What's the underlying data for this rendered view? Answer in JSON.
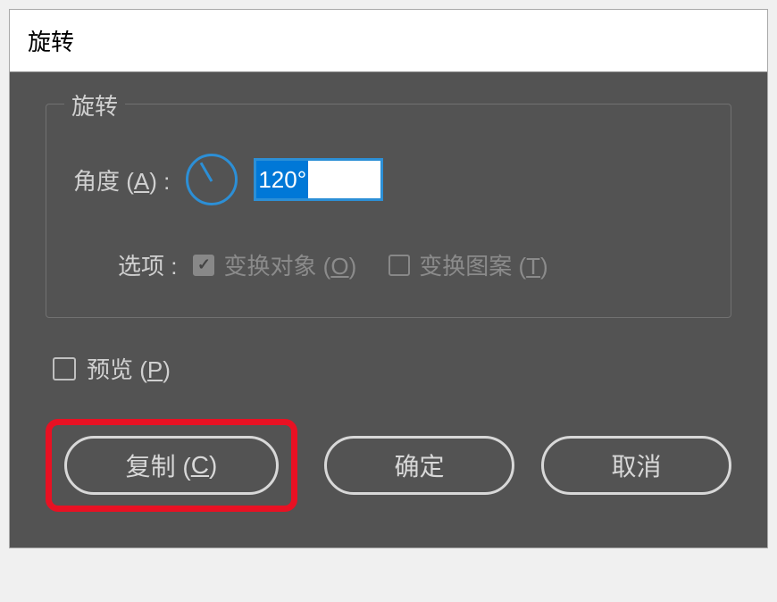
{
  "dialog": {
    "title": "旋转"
  },
  "fieldset": {
    "legend": "旋转",
    "angle_label_prefix": "角度 (",
    "angle_label_hotkey": "A",
    "angle_label_suffix": ") :",
    "angle_value": "120°"
  },
  "options": {
    "label": "选项 :",
    "transform_object_prefix": "变换对象 (",
    "transform_object_hotkey": "O",
    "transform_object_suffix": ")",
    "transform_object_checked": true,
    "transform_pattern_prefix": "变换图案 (",
    "transform_pattern_hotkey": "T",
    "transform_pattern_suffix": ")",
    "transform_pattern_checked": false
  },
  "preview": {
    "label_prefix": "预览 (",
    "label_hotkey": "P",
    "label_suffix": ")",
    "checked": false
  },
  "buttons": {
    "copy_prefix": "复制 (",
    "copy_hotkey": "C",
    "copy_suffix": ")",
    "ok": "确定",
    "cancel": "取消"
  }
}
